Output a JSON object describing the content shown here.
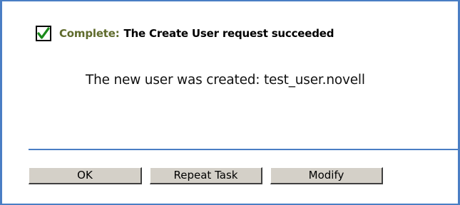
{
  "status": {
    "icon": "checkmark-icon",
    "check_color": "#1a8a1a",
    "prefix": "Complete:",
    "text": "The Create User request succeeded"
  },
  "message": "The new user was created: test_user.novell",
  "buttons": {
    "ok": "OK",
    "repeat": "Repeat Task",
    "modify": "Modify"
  },
  "colors": {
    "border": "#4a7ec4",
    "prefix": "#5f6b2c"
  }
}
